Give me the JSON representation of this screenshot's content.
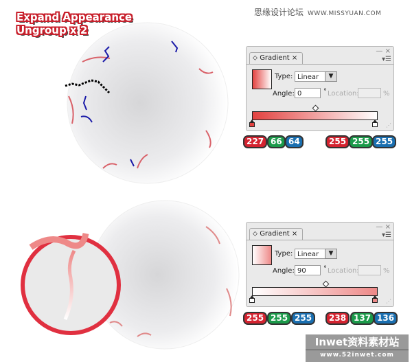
{
  "captions": {
    "line1": "Expand Appearance",
    "line2": "Ungroup x 2"
  },
  "site_header": {
    "name": "思缘设计论坛",
    "url": "WWW.MISSYUAN.COM"
  },
  "panels": [
    {
      "tab_label": "Gradient",
      "close": "×",
      "minimize": "—",
      "menu_icon": "▾☰",
      "type_label": "Type:",
      "type_value": "Linear",
      "angle_label": "Angle:",
      "angle_value": "0",
      "degree": "°",
      "location_label": "Location:",
      "location_value": "",
      "percent": "%",
      "gradient_from": "#e34240",
      "gradient_to": "#ffffff",
      "swatch": "linear-gradient(90deg,#e34240,#ffffff)",
      "left_rgb": [
        "227",
        "66",
        "64"
      ],
      "right_rgb": [
        "255",
        "255",
        "255"
      ]
    },
    {
      "tab_label": "Gradient",
      "close": "×",
      "minimize": "—",
      "menu_icon": "▾☰",
      "type_label": "Type:",
      "type_value": "Linear",
      "angle_label": "Angle:",
      "angle_value": "90",
      "degree": "°",
      "location_label": "Location:",
      "location_value": "",
      "percent": "%",
      "gradient_from": "#ffffff",
      "gradient_to": "#ee8988",
      "left_rgb": [
        "255",
        "255",
        "255"
      ],
      "right_rgb": [
        "238",
        "137",
        "136"
      ]
    }
  ],
  "watermark": {
    "title": "Inwet资料素材站",
    "url": "www.52inwet.com"
  }
}
